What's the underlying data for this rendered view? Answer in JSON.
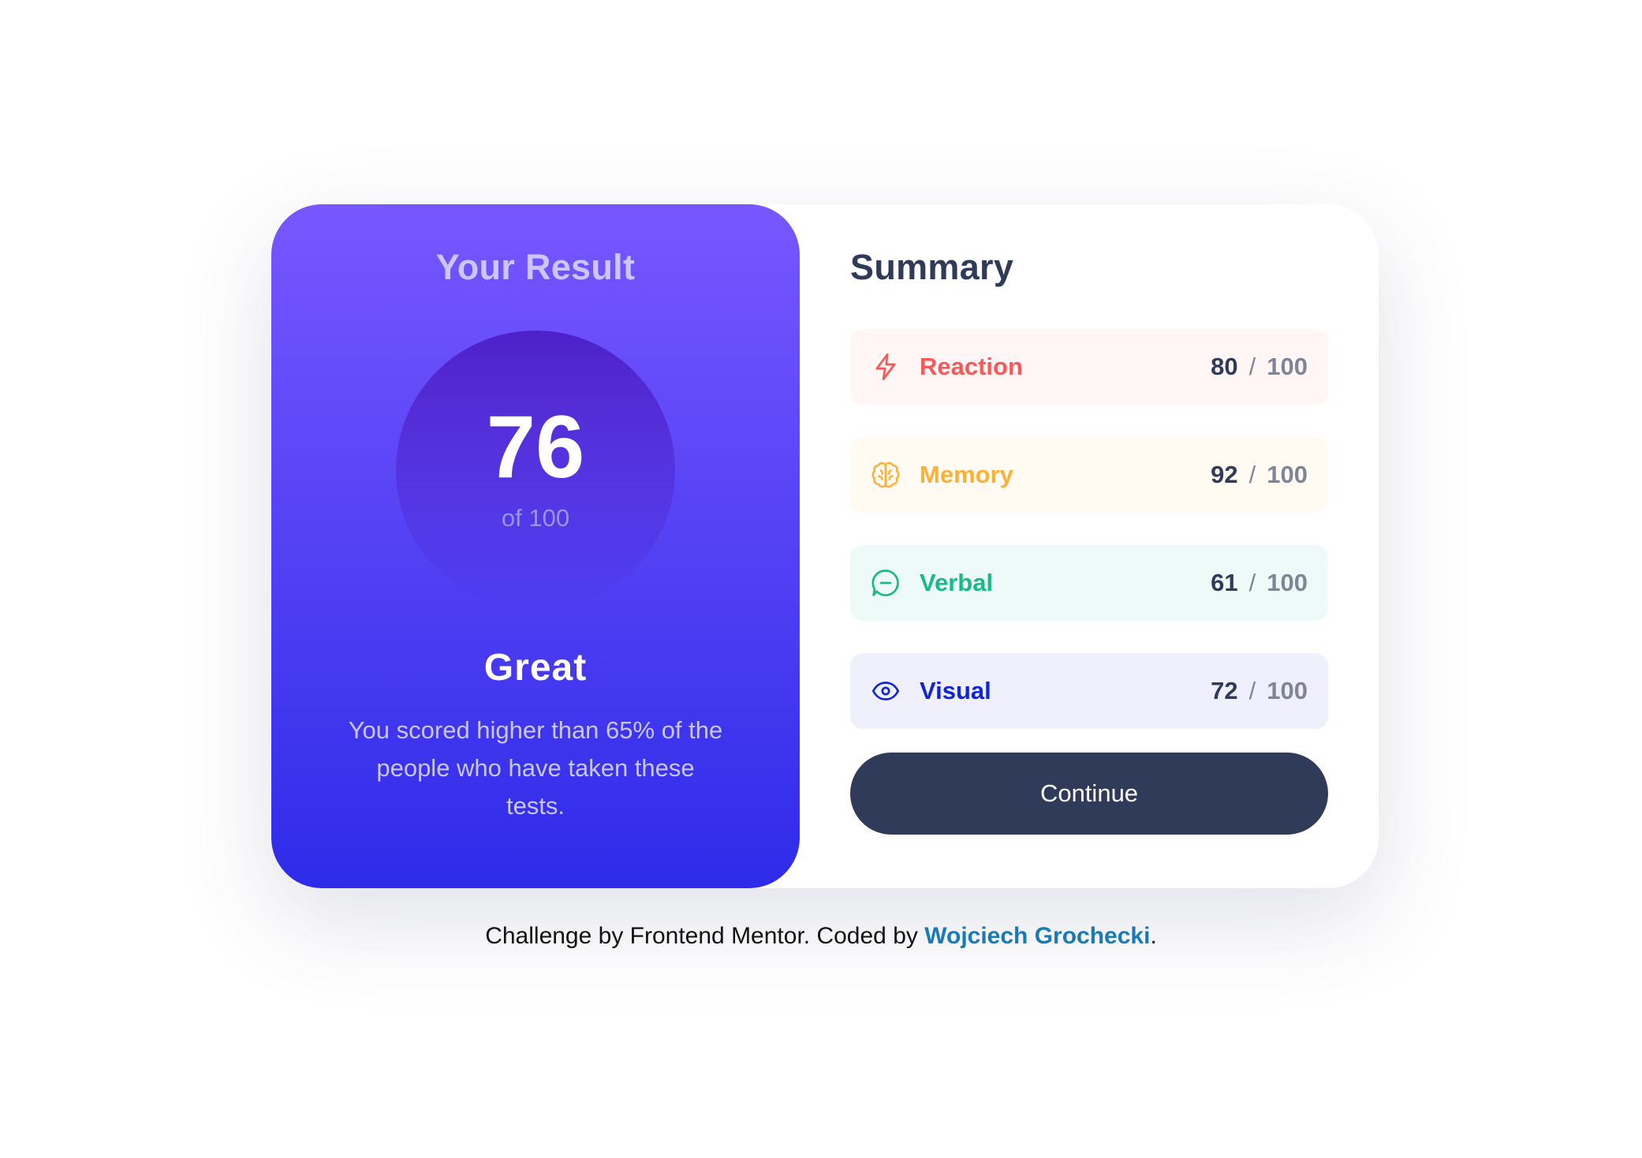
{
  "result": {
    "title": "Your Result",
    "score": "76",
    "of_label": "of 100",
    "rating": "Great",
    "description": "You scored higher than 65% of the people who have taken these tests."
  },
  "summary": {
    "title": "Summary",
    "items": [
      {
        "label": "Reaction",
        "score": "80",
        "slash": "/",
        "max": "100",
        "icon": "lightning-icon",
        "color": "#f55a5a",
        "bg": "#fff6f5"
      },
      {
        "label": "Memory",
        "score": "92",
        "slash": "/",
        "max": "100",
        "icon": "brain-icon",
        "color": "#fbb039",
        "bg": "#fffbf2"
      },
      {
        "label": "Verbal",
        "score": "61",
        "slash": "/",
        "max": "100",
        "icon": "chat-bubble-icon",
        "color": "#1ab98a",
        "bg": "#eefaf7"
      },
      {
        "label": "Visual",
        "score": "72",
        "slash": "/",
        "max": "100",
        "icon": "eye-icon",
        "color": "#1125d6",
        "bg": "#eff0fb"
      }
    ],
    "continue_label": "Continue"
  },
  "attribution": {
    "prefix": "Challenge by Frontend Mentor. Coded by ",
    "author": "Wojciech Grochecki",
    "suffix": "."
  },
  "colors": {
    "gradient_top": "#7857ff",
    "gradient_bottom": "#2e2be9",
    "dark_navy": "#303b5a",
    "link": "#1a7ab8"
  }
}
